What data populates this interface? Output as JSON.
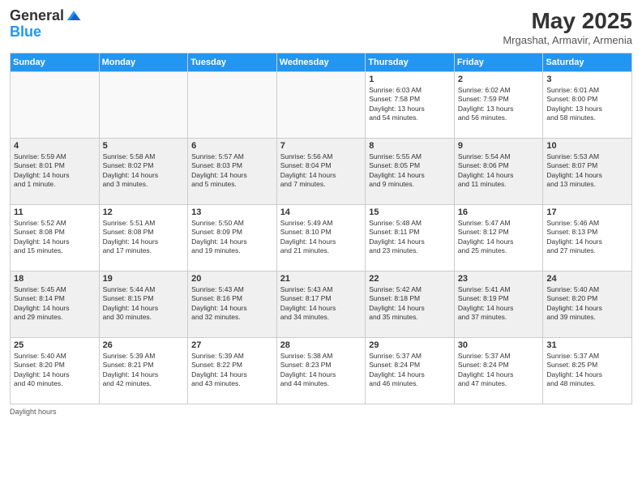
{
  "header": {
    "logo_general": "General",
    "logo_blue": "Blue",
    "month_year": "May 2025",
    "location": "Mrgashat, Armavir, Armenia"
  },
  "days_of_week": [
    "Sunday",
    "Monday",
    "Tuesday",
    "Wednesday",
    "Thursday",
    "Friday",
    "Saturday"
  ],
  "weeks": [
    [
      {
        "day": "",
        "info": "",
        "empty": true
      },
      {
        "day": "",
        "info": "",
        "empty": true
      },
      {
        "day": "",
        "info": "",
        "empty": true
      },
      {
        "day": "",
        "info": "",
        "empty": true
      },
      {
        "day": "1",
        "info": "Sunrise: 6:03 AM\nSunset: 7:58 PM\nDaylight: 13 hours\nand 54 minutes."
      },
      {
        "day": "2",
        "info": "Sunrise: 6:02 AM\nSunset: 7:59 PM\nDaylight: 13 hours\nand 56 minutes."
      },
      {
        "day": "3",
        "info": "Sunrise: 6:01 AM\nSunset: 8:00 PM\nDaylight: 13 hours\nand 58 minutes."
      }
    ],
    [
      {
        "day": "4",
        "info": "Sunrise: 5:59 AM\nSunset: 8:01 PM\nDaylight: 14 hours\nand 1 minute."
      },
      {
        "day": "5",
        "info": "Sunrise: 5:58 AM\nSunset: 8:02 PM\nDaylight: 14 hours\nand 3 minutes."
      },
      {
        "day": "6",
        "info": "Sunrise: 5:57 AM\nSunset: 8:03 PM\nDaylight: 14 hours\nand 5 minutes."
      },
      {
        "day": "7",
        "info": "Sunrise: 5:56 AM\nSunset: 8:04 PM\nDaylight: 14 hours\nand 7 minutes."
      },
      {
        "day": "8",
        "info": "Sunrise: 5:55 AM\nSunset: 8:05 PM\nDaylight: 14 hours\nand 9 minutes."
      },
      {
        "day": "9",
        "info": "Sunrise: 5:54 AM\nSunset: 8:06 PM\nDaylight: 14 hours\nand 11 minutes."
      },
      {
        "day": "10",
        "info": "Sunrise: 5:53 AM\nSunset: 8:07 PM\nDaylight: 14 hours\nand 13 minutes."
      }
    ],
    [
      {
        "day": "11",
        "info": "Sunrise: 5:52 AM\nSunset: 8:08 PM\nDaylight: 14 hours\nand 15 minutes."
      },
      {
        "day": "12",
        "info": "Sunrise: 5:51 AM\nSunset: 8:08 PM\nDaylight: 14 hours\nand 17 minutes."
      },
      {
        "day": "13",
        "info": "Sunrise: 5:50 AM\nSunset: 8:09 PM\nDaylight: 14 hours\nand 19 minutes."
      },
      {
        "day": "14",
        "info": "Sunrise: 5:49 AM\nSunset: 8:10 PM\nDaylight: 14 hours\nand 21 minutes."
      },
      {
        "day": "15",
        "info": "Sunrise: 5:48 AM\nSunset: 8:11 PM\nDaylight: 14 hours\nand 23 minutes."
      },
      {
        "day": "16",
        "info": "Sunrise: 5:47 AM\nSunset: 8:12 PM\nDaylight: 14 hours\nand 25 minutes."
      },
      {
        "day": "17",
        "info": "Sunrise: 5:46 AM\nSunset: 8:13 PM\nDaylight: 14 hours\nand 27 minutes."
      }
    ],
    [
      {
        "day": "18",
        "info": "Sunrise: 5:45 AM\nSunset: 8:14 PM\nDaylight: 14 hours\nand 29 minutes."
      },
      {
        "day": "19",
        "info": "Sunrise: 5:44 AM\nSunset: 8:15 PM\nDaylight: 14 hours\nand 30 minutes."
      },
      {
        "day": "20",
        "info": "Sunrise: 5:43 AM\nSunset: 8:16 PM\nDaylight: 14 hours\nand 32 minutes."
      },
      {
        "day": "21",
        "info": "Sunrise: 5:43 AM\nSunset: 8:17 PM\nDaylight: 14 hours\nand 34 minutes."
      },
      {
        "day": "22",
        "info": "Sunrise: 5:42 AM\nSunset: 8:18 PM\nDaylight: 14 hours\nand 35 minutes."
      },
      {
        "day": "23",
        "info": "Sunrise: 5:41 AM\nSunset: 8:19 PM\nDaylight: 14 hours\nand 37 minutes."
      },
      {
        "day": "24",
        "info": "Sunrise: 5:40 AM\nSunset: 8:20 PM\nDaylight: 14 hours\nand 39 minutes."
      }
    ],
    [
      {
        "day": "25",
        "info": "Sunrise: 5:40 AM\nSunset: 8:20 PM\nDaylight: 14 hours\nand 40 minutes."
      },
      {
        "day": "26",
        "info": "Sunrise: 5:39 AM\nSunset: 8:21 PM\nDaylight: 14 hours\nand 42 minutes."
      },
      {
        "day": "27",
        "info": "Sunrise: 5:39 AM\nSunset: 8:22 PM\nDaylight: 14 hours\nand 43 minutes."
      },
      {
        "day": "28",
        "info": "Sunrise: 5:38 AM\nSunset: 8:23 PM\nDaylight: 14 hours\nand 44 minutes."
      },
      {
        "day": "29",
        "info": "Sunrise: 5:37 AM\nSunset: 8:24 PM\nDaylight: 14 hours\nand 46 minutes."
      },
      {
        "day": "30",
        "info": "Sunrise: 5:37 AM\nSunset: 8:24 PM\nDaylight: 14 hours\nand 47 minutes."
      },
      {
        "day": "31",
        "info": "Sunrise: 5:37 AM\nSunset: 8:25 PM\nDaylight: 14 hours\nand 48 minutes."
      }
    ]
  ],
  "footer": {
    "daylight_label": "Daylight hours"
  }
}
